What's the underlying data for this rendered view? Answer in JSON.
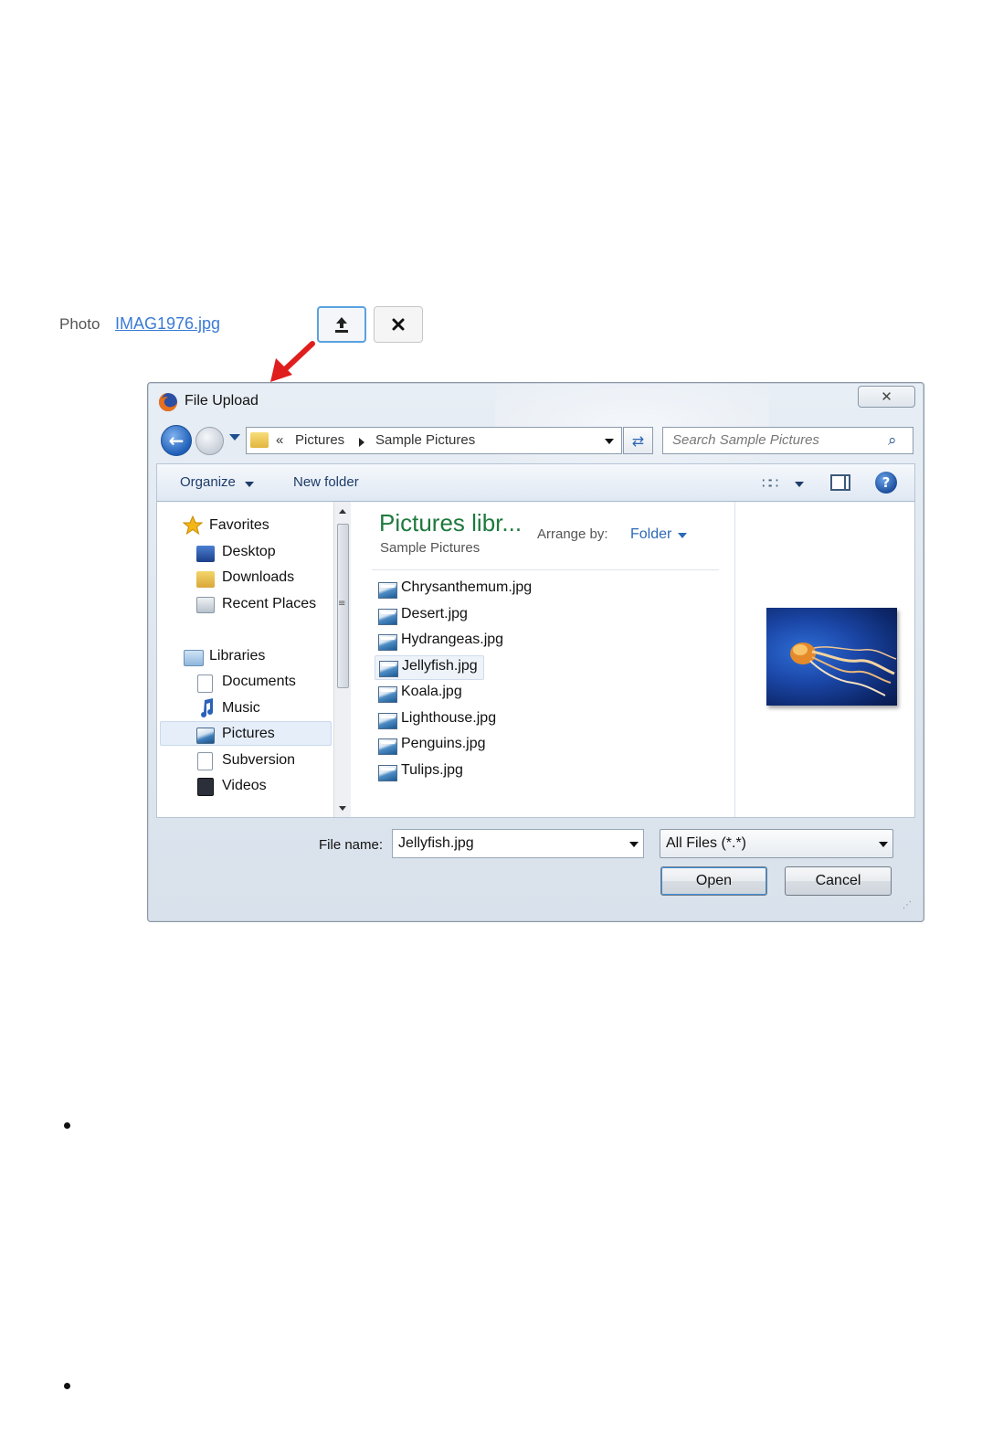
{
  "form": {
    "label": "Photo",
    "file_link": "IMAG1976.jpg",
    "upload_icon": "upload-icon",
    "remove_icon": "close-icon"
  },
  "dialog": {
    "title": "File Upload",
    "close_glyph": "✕",
    "address": {
      "chevrons": "«",
      "crumbs": [
        "Pictures",
        "Sample Pictures"
      ]
    },
    "search_placeholder": "Search Sample Pictures",
    "toolbar": {
      "organize": "Organize",
      "new_folder": "New folder"
    },
    "nav": {
      "favorites_header": "Favorites",
      "favorites": [
        "Desktop",
        "Downloads",
        "Recent Places"
      ],
      "libraries_header": "Libraries",
      "libraries": [
        "Documents",
        "Music",
        "Pictures",
        "Subversion",
        "Videos"
      ],
      "selected": "Pictures"
    },
    "library": {
      "title": "Pictures libr...",
      "subtitle": "Sample Pictures",
      "arrange_label": "Arrange by:",
      "arrange_value": "Folder"
    },
    "files": [
      "Chrysanthemum.jpg",
      "Desert.jpg",
      "Hydrangeas.jpg",
      "Jellyfish.jpg",
      "Koala.jpg",
      "Lighthouse.jpg",
      "Penguins.jpg",
      "Tulips.jpg"
    ],
    "selected_file": "Jellyfish.jpg",
    "file_name_label": "File name:",
    "file_name_value": "Jellyfish.jpg",
    "filter_value": "All Files (*.*)",
    "open_button": "Open",
    "cancel_button": "Cancel"
  },
  "colors": {
    "accent_link": "#3a7bd5",
    "library_title": "#1e7a3e",
    "annotation_arrow": "#e01e1e"
  }
}
